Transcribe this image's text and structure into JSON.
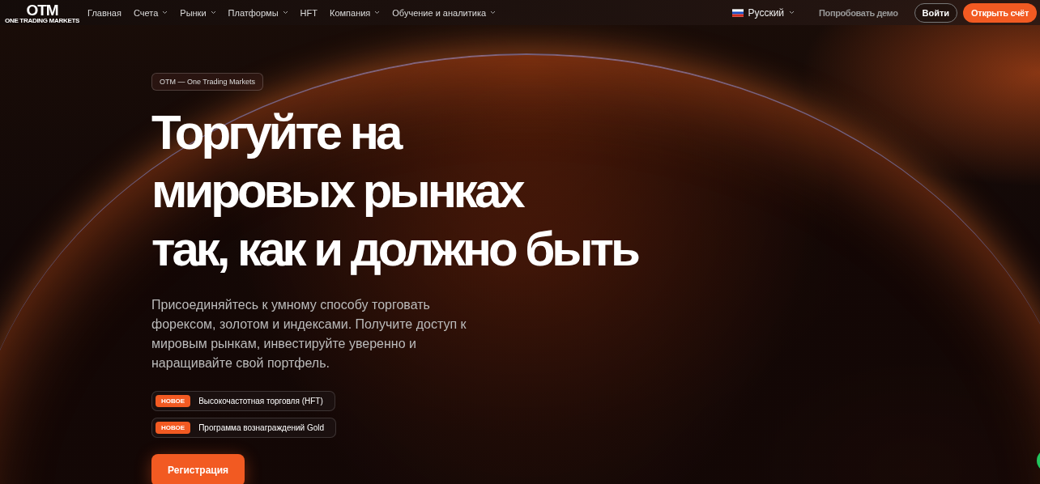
{
  "nav": {
    "logo": {
      "mark": "OTM",
      "tagline": "ONE TRADING MARKETS"
    },
    "items": [
      {
        "label": "Главная",
        "dropdown": false
      },
      {
        "label": "Счета",
        "dropdown": true
      },
      {
        "label": "Рынки",
        "dropdown": true
      },
      {
        "label": "Платформы",
        "dropdown": true
      },
      {
        "label": "HFT",
        "dropdown": false
      },
      {
        "label": "Компания",
        "dropdown": true
      },
      {
        "label": "Обучение и аналитика",
        "dropdown": true
      }
    ],
    "language": "Русский",
    "demo": "Попробовать демо",
    "login": "Войти",
    "open_account": "Открыть счёт"
  },
  "hero": {
    "eyebrow": "OTM — One Trading Markets",
    "title": "Торгуйте на\nмировых рынках\nтак, как и должно быть",
    "description": "Присоединяйтесь к умному способу торговать\nфорексом, золотом и индексами. Получите доступ к\nмировым рынкам, инвестируйте уверенно и\nнаращивайте свой портфель.",
    "features": [
      {
        "badge": "НОВОЕ",
        "text": "Высокочастотная торговля (HFT)"
      },
      {
        "badge": "НОВОЕ",
        "text": "Программа вознаграждений Gold"
      }
    ],
    "cta": "Регистрация"
  }
}
